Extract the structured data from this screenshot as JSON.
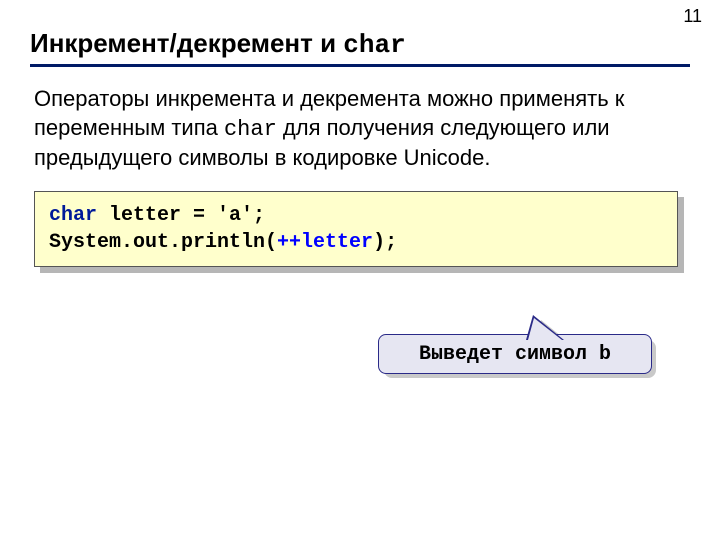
{
  "pageNumber": "11",
  "title": {
    "prefix": "Инкремент/декремент и ",
    "mono": "char"
  },
  "paragraph": {
    "p1": "Операторы инкремента и декремента можно применять к переменным типа ",
    "mono": "char",
    "p2": " для получения следующего или предыдущего символы в кодировке Unicode."
  },
  "code": {
    "line1": {
      "kw": "char",
      "rest": " letter = 'a';"
    },
    "line2": {
      "a": "System.out.println(",
      "op": "++letter",
      "b": ");"
    }
  },
  "callout": "Выведет символ b"
}
